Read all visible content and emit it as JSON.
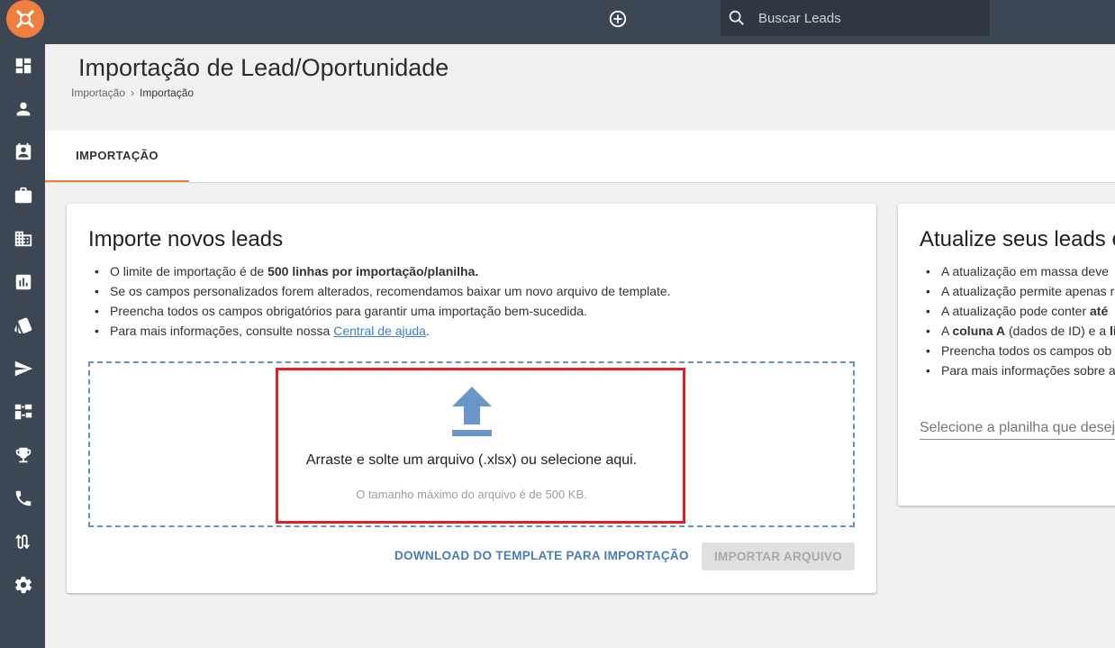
{
  "topbar": {
    "search_placeholder": "Buscar Leads"
  },
  "sidebar": {
    "items": [
      {
        "icon": "dashboard-icon"
      },
      {
        "icon": "person-icon"
      },
      {
        "icon": "contact-card-icon"
      },
      {
        "icon": "briefcase-icon"
      },
      {
        "icon": "building-icon"
      },
      {
        "icon": "report-chart-icon"
      },
      {
        "icon": "tags-icon"
      },
      {
        "icon": "send-icon"
      },
      {
        "icon": "hierarchy-icon"
      },
      {
        "icon": "trophy-icon"
      },
      {
        "icon": "phone-icon"
      },
      {
        "icon": "swap-arrows-icon"
      },
      {
        "icon": "gear-icon"
      }
    ]
  },
  "header": {
    "title": "Importação de Lead/Oportunidade",
    "breadcrumb": [
      "Importação",
      "Importação"
    ]
  },
  "tabs": [
    {
      "label": "IMPORTAÇÃO",
      "active": true
    }
  ],
  "import_card": {
    "title": "Importe novos leads",
    "bullets": {
      "b1_pre": "O limite de importação é de ",
      "b1_bold": "500 linhas por importação/planilha.",
      "b2": "Se os campos personalizados forem alterados, recomendamos baixar um novo arquivo de template.",
      "b3": "Preencha todos os campos obrigatórios para garantir uma importação bem-sucedida.",
      "b4_pre": "Para mais informações, consulte nossa ",
      "b4_link": "Central de ajuda",
      "b4_post": "."
    },
    "dropzone": {
      "text": "Arraste e solte um arquivo (.xlsx) ou selecione aqui.",
      "subtext": "O tamanho máximo do arquivo é de 500 KB."
    },
    "download_label": "DOWNLOAD DO TEMPLATE PARA IMPORTAÇÃO",
    "import_label": "IMPORTAR ARQUIVO"
  },
  "update_card": {
    "title": "Atualize seus leads e",
    "bullets": {
      "b1": "A atualização em massa deve",
      "b2": "A atualização permite apenas r",
      "b3_pre": "A atualização pode conter ",
      "b3_bold": "até",
      "b4_pre": "A ",
      "b4_bold": "coluna A",
      "b4_mid": " (dados de ID) e a ",
      "b4_bold2": "li",
      "b5": "Preencha todos os campos ob",
      "b6": "Para mais informações sobre a"
    },
    "select_placeholder": "Selecione a planilha que desej"
  },
  "colors": {
    "sidebar": "#3d4753",
    "accent": "#f07e3f",
    "link": "#4a7cb3",
    "highlight": "#e31e24"
  }
}
